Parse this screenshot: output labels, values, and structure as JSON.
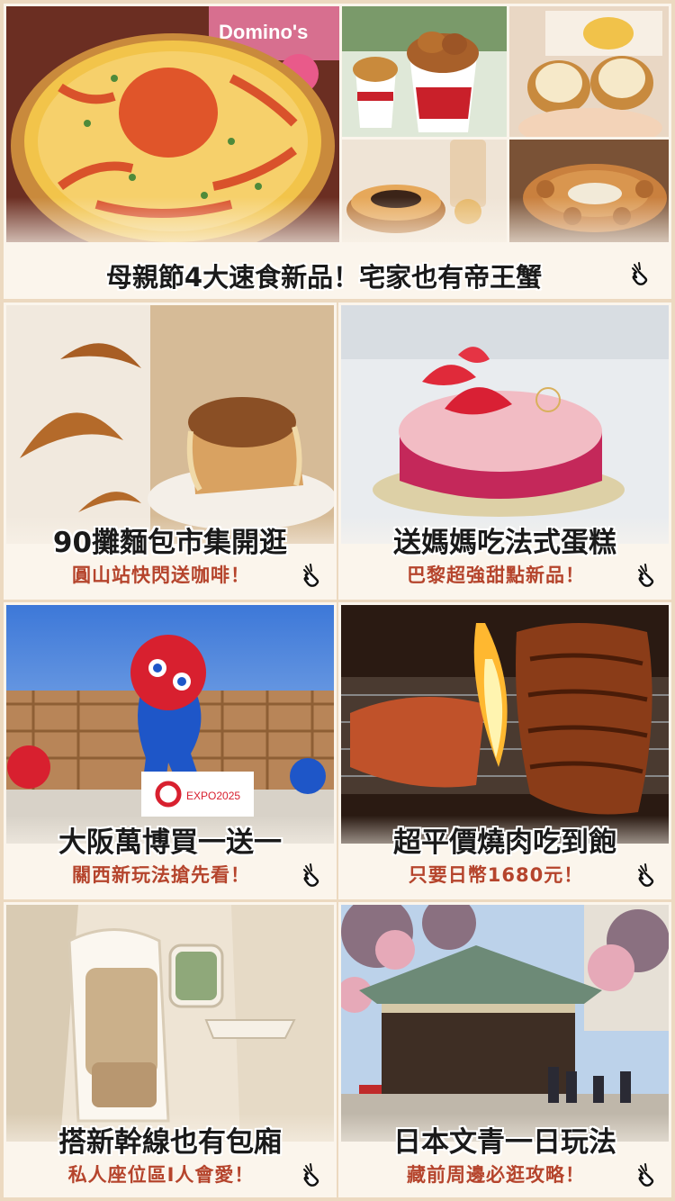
{
  "hero": {
    "title": "母親節4大速食新品！宅家也有帝王蟹",
    "brand_sign": "Domino's"
  },
  "cards": [
    {
      "title": "90攤麵包市集開逛",
      "subtitle": "圓山站快閃送咖啡！"
    },
    {
      "title": "送媽媽吃法式蛋糕",
      "subtitle": "巴黎超強甜點新品！"
    },
    {
      "title": "大阪萬博買一送一",
      "subtitle": "關西新玩法搶先看！",
      "sign": "EXPO2025"
    },
    {
      "title": "超平價燒肉吃到飽",
      "subtitle": "只要日幣1680元！"
    },
    {
      "title": "搭新幹線也有包廂",
      "subtitle": "私人座位區I人會愛！"
    },
    {
      "title": "日本文青一日玩法",
      "subtitle": "藏前周邊必逛攻略！"
    }
  ],
  "colors": {
    "background": "#ecd9c0",
    "card": "#fbf5ec",
    "subtitle": "#b5442c"
  },
  "icons": [
    "pointing-hand-icon"
  ]
}
